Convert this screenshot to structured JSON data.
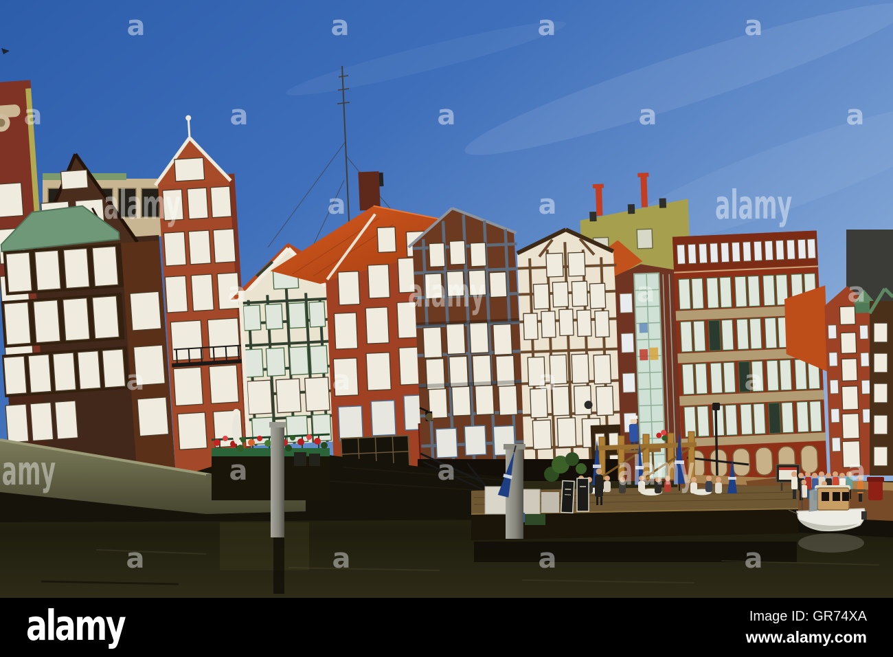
{
  "footer": {
    "logo": "alamy",
    "image_id": "Image ID: GR74XA",
    "website": "www.alamy.com"
  },
  "watermark": {
    "logo": "alamy",
    "letter": "a"
  },
  "colors": {
    "footer_bg": "#000000",
    "footer_text": "#ffffff",
    "watermark": "#ffffff",
    "sky_top": "#2c5dab",
    "sky_horizon": "#8fb0da",
    "water_dark": "#23200f",
    "brick_sunlit": "#a34929",
    "brick_dark": "#6e3320",
    "roof_orange": "#c8551d",
    "copper_green": "#6f9878",
    "timber_dark": "#42281a",
    "cream_plaster": "#ebe3d0",
    "olive_facade": "#a6a04e",
    "umbrella_navy": "#1e3f85"
  }
}
